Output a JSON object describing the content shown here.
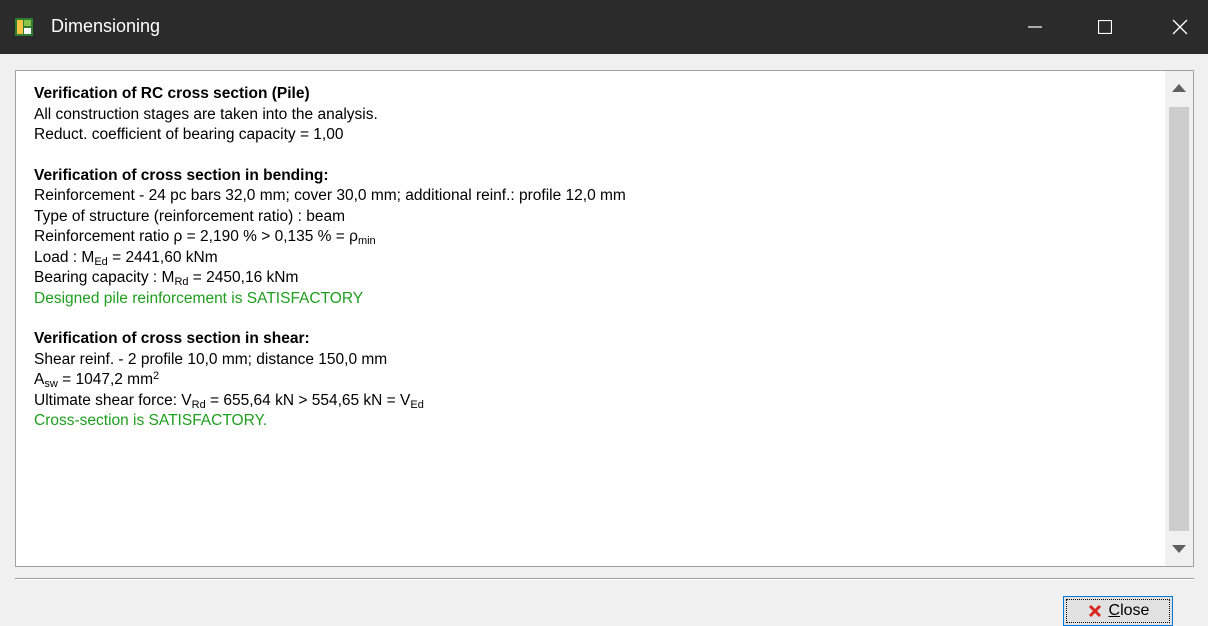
{
  "window": {
    "title": "Dimensioning"
  },
  "report": {
    "heading": "Verification of RC cross section (Pile)",
    "stages_note": "All construction stages are taken into the analysis.",
    "reduct_coef": "Reduct. coefficient of bearing capacity = 1,00",
    "bending": {
      "heading": "Verification of cross section in bending:",
      "reinforcement": "Reinforcement - 24 pc bars 32,0 mm; cover 30,0 mm; additional reinf.: profile 12,0 mm",
      "structure_type": "Type of structure (reinforcement ratio) : beam",
      "ratio_prefix": "Reinforcement ratio ρ = 2,190 % > 0,135 % = ρ",
      "ratio_sub": "min",
      "load_prefix": "Load : M",
      "load_sub": "Ed",
      "load_value": " = 2441,60 kNm",
      "capacity_prefix": "Bearing capacity : M",
      "capacity_sub": "Rd",
      "capacity_value": " = 2450,16 kNm",
      "result": "Designed pile reinforcement is SATISFACTORY"
    },
    "shear": {
      "heading": "Verification of cross section in shear:",
      "reinforcement": "Shear reinf. - 2 profile 10,0 mm; distance 150,0 mm",
      "asw_prefix": "A",
      "asw_sub": "sw",
      "asw_value": " = 1047,2 mm",
      "asw_sup": "2",
      "force_prefix": "Ultimate shear force: V",
      "force_sub1": "Rd",
      "force_mid": " = 655,64 kN > 554,65 kN = V",
      "force_sub2": "Ed",
      "result": "Cross-section is SATISFACTORY."
    }
  },
  "footer": {
    "close_label_first": "C",
    "close_label_rest": "lose"
  },
  "colors": {
    "titlebar": "#2b2b2b",
    "ok_text": "#1e9e1e",
    "close_icon": "#d9261c"
  },
  "icons": [
    "app-icon",
    "minimize-icon",
    "maximize-icon",
    "close-icon",
    "scroll-up-arrow-icon",
    "scroll-down-arrow-icon",
    "red-x-icon"
  ]
}
